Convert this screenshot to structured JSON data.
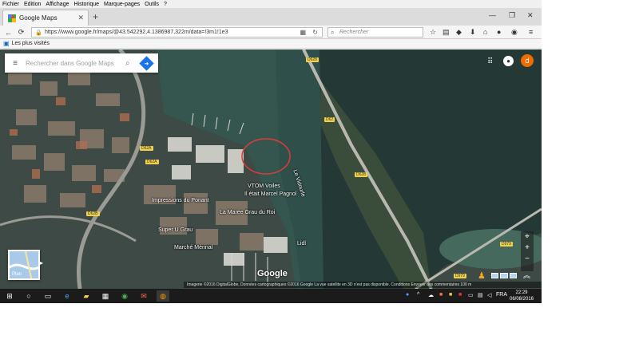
{
  "menu": [
    "Fichier",
    "Edition",
    "Affichage",
    "Historique",
    "Marque-pages",
    "Outils",
    "?"
  ],
  "tab": {
    "title": "Google Maps"
  },
  "address": {
    "url": "https://www.google.fr/maps/@43.542292,4.1386987,322m/data=!3m1!1e3"
  },
  "search": {
    "placeholder": "Rechercher"
  },
  "bookmarks": {
    "item": "Les plus visités"
  },
  "maps": {
    "search_placeholder": "Rechercher dans Google Maps",
    "account_initial": "d",
    "badge_label": "Plan",
    "logo": "Google",
    "attribution": "Imagerie ©2016 DigitalGlobe, Données cartographiques ©2016 Google   La vue satellite en 3D n'est pas disponible.   Conditions   Envoyer des commentaires   100 m",
    "labels": {
      "river": "Le Vidourle",
      "place1": "VTOM Voiles",
      "place2": "Il était Marcel Pagnol",
      "place3": "Impressions du Ponant",
      "place4": "La Marée Grau du Roi",
      "place5": "Super U Grau",
      "place6": "Marché Mérinal",
      "place7": "Lidl"
    },
    "roads": [
      "D628",
      "D62A",
      "D62A",
      "D62B",
      "D628",
      "D979",
      "D979",
      "D62"
    ]
  },
  "taskbar": {
    "lang": "FRA",
    "time": "22:29",
    "date": "06/08/2016"
  },
  "colors": {
    "accent": "#1a73e8",
    "avatar": "#ef6c00",
    "annotation": "#e53935"
  }
}
